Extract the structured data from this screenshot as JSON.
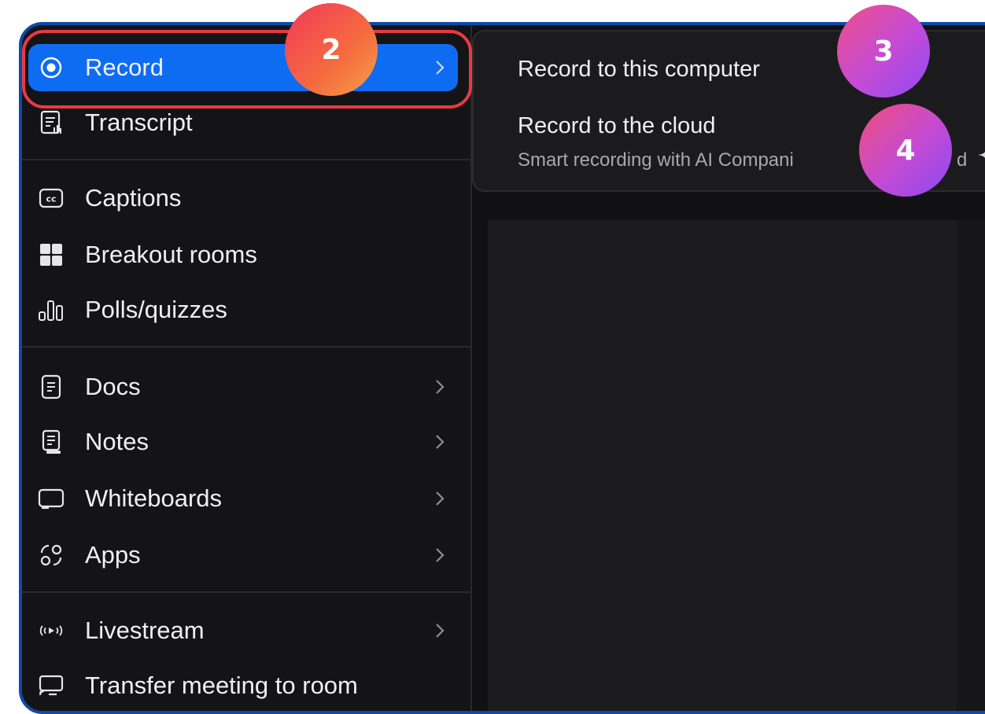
{
  "sidebar": {
    "items": [
      {
        "label": "Record",
        "icon": "record-radio-icon",
        "has_submenu": true,
        "active": true
      },
      {
        "label": "Transcript",
        "icon": "transcript-icon",
        "has_submenu": false
      },
      {
        "label": "Captions",
        "icon": "captions-cc-icon",
        "has_submenu": false
      },
      {
        "label": "Breakout rooms",
        "icon": "breakout-rooms-grid-icon",
        "has_submenu": false
      },
      {
        "label": "Polls/quizzes",
        "icon": "polls-bar-chart-icon",
        "has_submenu": false
      },
      {
        "label": "Docs",
        "icon": "docs-icon",
        "has_submenu": true
      },
      {
        "label": "Notes",
        "icon": "notes-icon",
        "has_submenu": true
      },
      {
        "label": "Whiteboards",
        "icon": "whiteboard-icon",
        "has_submenu": true
      },
      {
        "label": "Apps",
        "icon": "apps-icon",
        "has_submenu": true
      },
      {
        "label": "Livestream",
        "icon": "livestream-icon",
        "has_submenu": true
      },
      {
        "label": "Transfer meeting to room",
        "icon": "transfer-room-icon",
        "has_submenu": false
      }
    ]
  },
  "submenu": {
    "record_local": "Record to this computer",
    "record_cloud": "Record to the cloud",
    "record_cloud_desc": "Smart recording with AI Compani",
    "desc_tail": "d"
  },
  "badges": {
    "b2": "2",
    "b3": "3",
    "b4": "4"
  },
  "colors": {
    "active_blue": "#0e6cf2",
    "highlight_red": "#e83a44",
    "frame_border": "#0e4aa6",
    "background": "#111113"
  }
}
